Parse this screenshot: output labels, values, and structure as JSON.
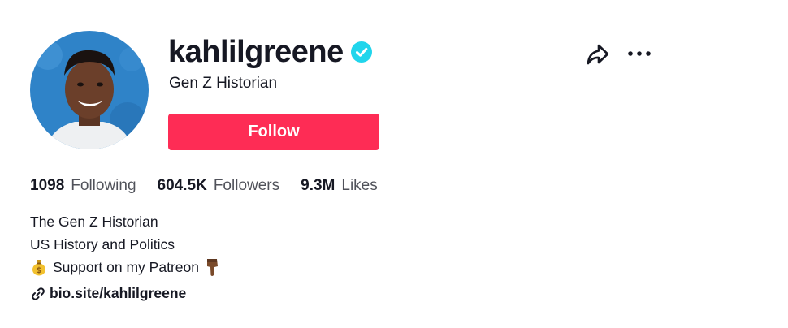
{
  "profile": {
    "username": "kahlilgreene",
    "nickname": "Gen Z Historian",
    "verified": true,
    "follow_label": "Follow"
  },
  "stats": {
    "following_count": "1098",
    "following_label": "Following",
    "followers_count": "604.5K",
    "followers_label": "Followers",
    "likes_count": "9.3M",
    "likes_label": "Likes"
  },
  "bio": {
    "line1": "The Gen Z Historian",
    "line2": "US History and Politics",
    "line3": "Support on my Patreon",
    "line3_prefix_icon": "money-bag-icon",
    "line3_suffix_icon": "pointing-down-hand-icon"
  },
  "link": {
    "text": "bio.site/kahlilgreene",
    "icon": "link-icon"
  },
  "icons": {
    "verified": "verified-badge-icon",
    "share": "share-arrow-icon",
    "more": "more-dots-icon"
  },
  "colors": {
    "accent": "#fe2c55",
    "verified": "#20d5ec",
    "text_primary": "#161823",
    "text_secondary": "#5a5b63"
  }
}
